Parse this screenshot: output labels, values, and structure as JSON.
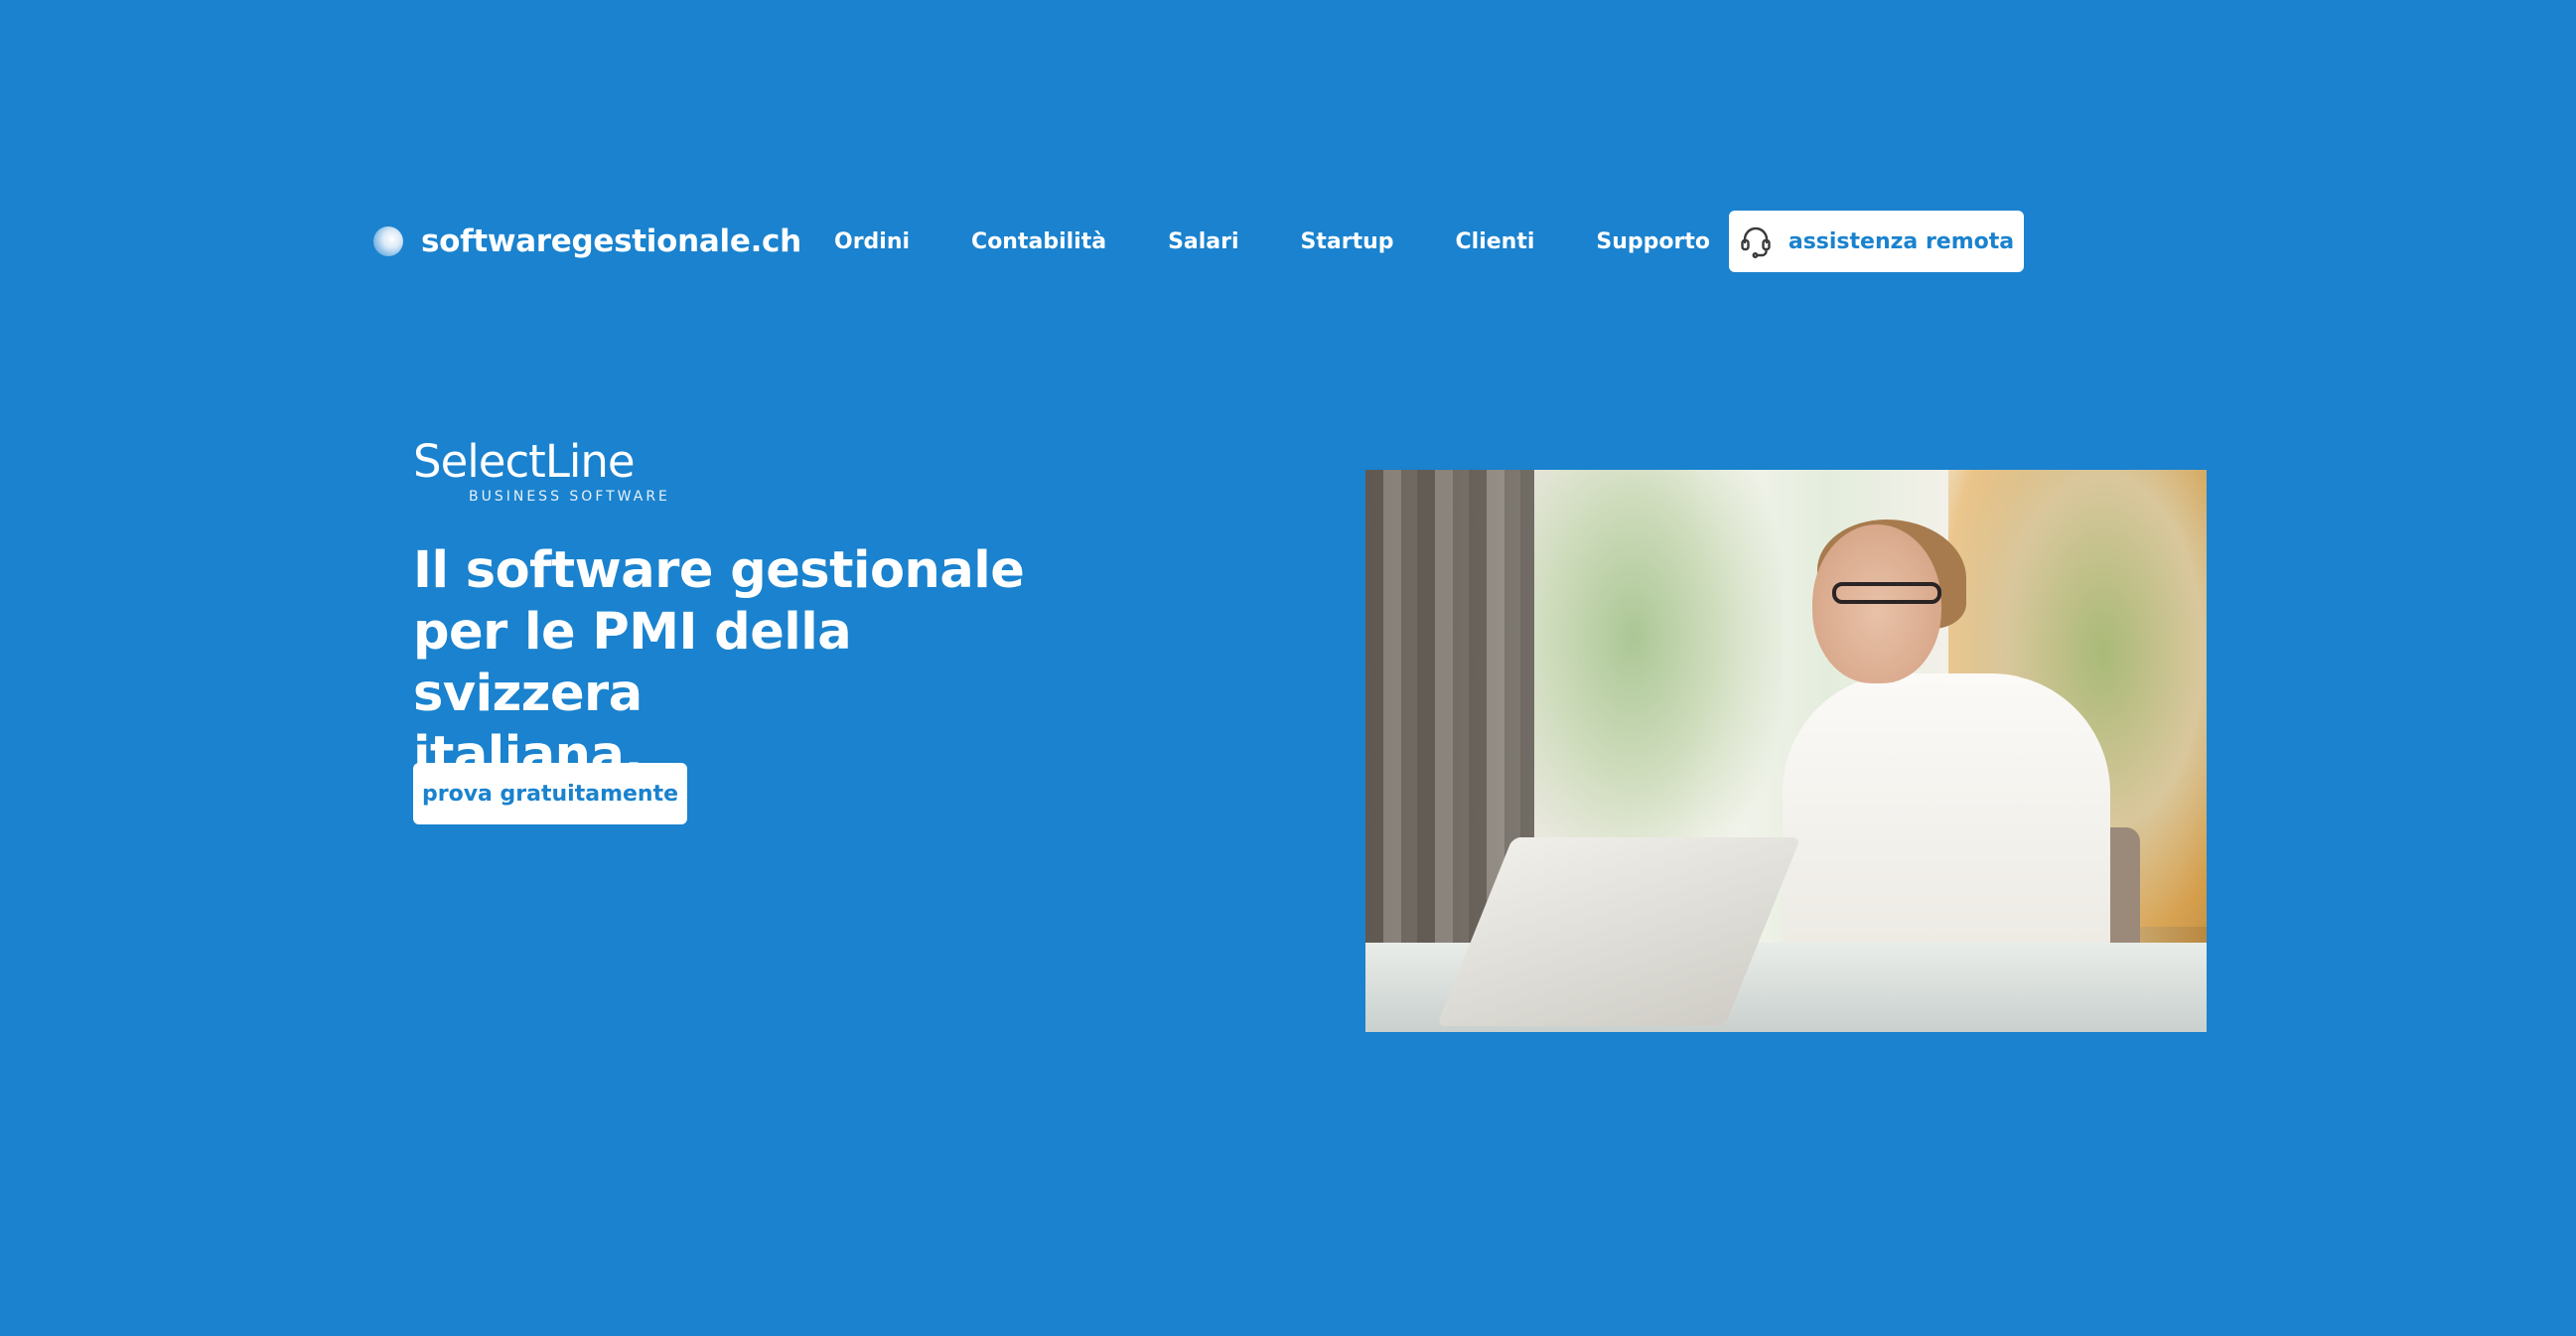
{
  "header": {
    "logo_text": "softwaregestionale.ch",
    "nav": [
      {
        "label": "Ordini"
      },
      {
        "label": "Contabilità"
      },
      {
        "label": "Salari"
      },
      {
        "label": "Startup"
      },
      {
        "label": "Clienti"
      },
      {
        "label": "Supporto"
      }
    ],
    "remote_button": {
      "label": "assistenza remota",
      "icon": "headset-icon"
    }
  },
  "hero": {
    "brand_name": "SelectLine",
    "brand_sub": "BUSINESS SOFTWARE",
    "headline_lines": [
      "Il software gestionale",
      "per le PMI della svizzera",
      "italiana."
    ],
    "cta_label": "prova gratuitamente"
  },
  "colors": {
    "background": "#1a82ce",
    "button_bg": "#ffffff",
    "button_text": "#1a82ce"
  }
}
